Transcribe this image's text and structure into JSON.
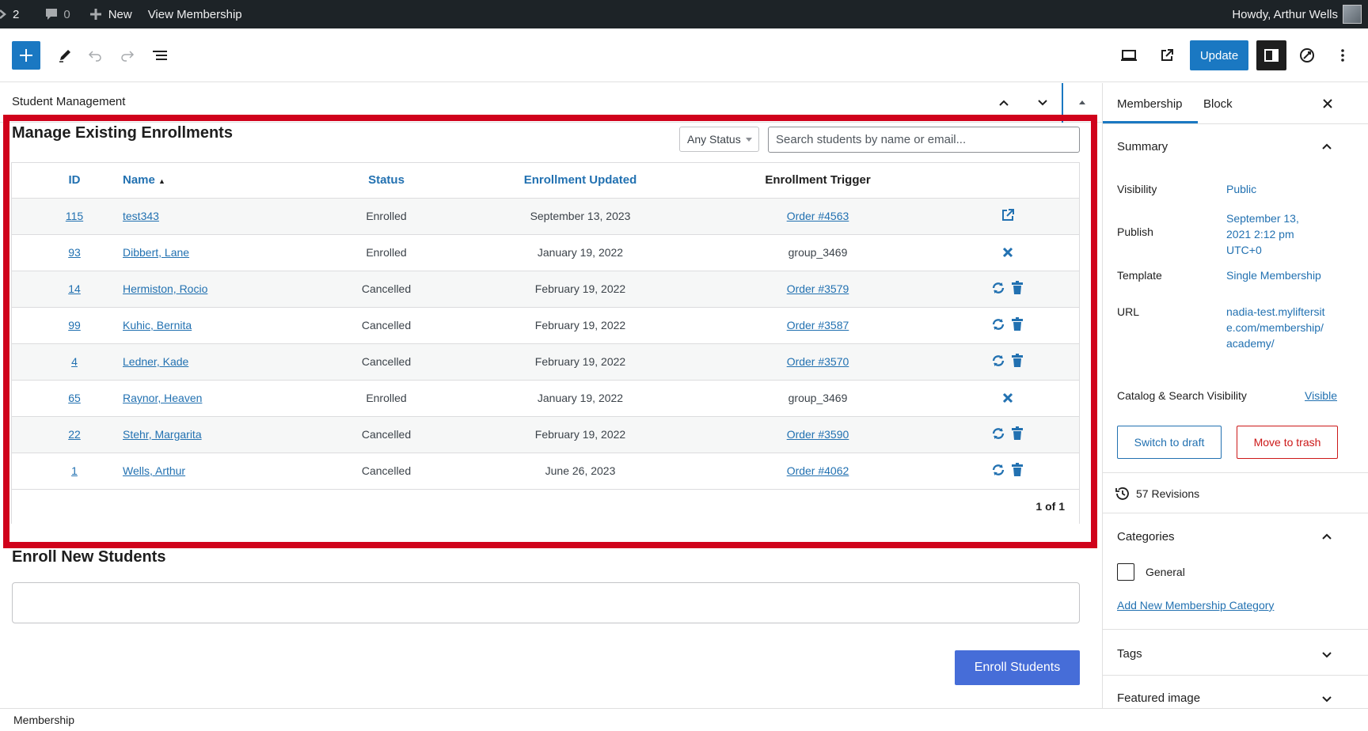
{
  "adminbar": {
    "updates_count": "2",
    "comments_count": "0",
    "new_label": "New",
    "view_label": "View Membership",
    "howdy": "Howdy, Arthur Wells"
  },
  "toolbar": {
    "update_label": "Update"
  },
  "panel": {
    "title": "Student Management"
  },
  "enrollments": {
    "title": "Manage Existing Enrollments",
    "status_filter": "Any Status",
    "search_placeholder": "Search students by name or email...",
    "columns": {
      "id": "ID",
      "name": "Name",
      "name_sort": "▲",
      "status": "Status",
      "updated": "Enrollment Updated",
      "trigger": "Enrollment Trigger"
    },
    "rows": [
      {
        "id": "115",
        "name": "test343",
        "status": "Enrolled",
        "updated": "September 13, 2023",
        "trigger": "Order #4563",
        "trigger_link": true,
        "actions": [
          "external-link"
        ]
      },
      {
        "id": "93",
        "name": "Dibbert, Lane",
        "status": "Enrolled",
        "updated": "January 19, 2022",
        "trigger": "group_3469",
        "trigger_link": false,
        "actions": [
          "close"
        ]
      },
      {
        "id": "14",
        "name": "Hermiston, Rocio",
        "status": "Cancelled",
        "updated": "February 19, 2022",
        "trigger": "Order #3579",
        "trigger_link": true,
        "actions": [
          "reenroll",
          "trash"
        ]
      },
      {
        "id": "99",
        "name": "Kuhic, Bernita",
        "status": "Cancelled",
        "updated": "February 19, 2022",
        "trigger": "Order #3587",
        "trigger_link": true,
        "actions": [
          "reenroll",
          "trash"
        ]
      },
      {
        "id": "4",
        "name": "Ledner, Kade",
        "status": "Cancelled",
        "updated": "February 19, 2022",
        "trigger": "Order #3570",
        "trigger_link": true,
        "actions": [
          "reenroll",
          "trash"
        ]
      },
      {
        "id": "65",
        "name": "Raynor, Heaven",
        "status": "Enrolled",
        "updated": "January 19, 2022",
        "trigger": "group_3469",
        "trigger_link": false,
        "actions": [
          "close"
        ]
      },
      {
        "id": "22",
        "name": "Stehr, Margarita",
        "status": "Cancelled",
        "updated": "February 19, 2022",
        "trigger": "Order #3590",
        "trigger_link": true,
        "actions": [
          "reenroll",
          "trash"
        ]
      },
      {
        "id": "1",
        "name": "Wells, Arthur",
        "status": "Cancelled",
        "updated": "June 26, 2023",
        "trigger": "Order #4062",
        "trigger_link": true,
        "actions": [
          "reenroll",
          "trash"
        ]
      }
    ],
    "pagination": "1 of 1"
  },
  "enroll_new": {
    "title": "Enroll New Students",
    "button_label": "Enroll Students"
  },
  "footer": {
    "breadcrumb": "Membership"
  },
  "sidebar": {
    "tabs": [
      "Membership",
      "Block"
    ],
    "summary": {
      "title": "Summary",
      "visibility_label": "Visibility",
      "visibility_value": "Public",
      "publish_label": "Publish",
      "publish_value": "September 13, 2021 2:12 pm UTC+0",
      "template_label": "Template",
      "template_value": "Single Membership",
      "url_label": "URL",
      "url_value": "nadia-test.myliftersite.com/membership/academy/",
      "catalog_label": "Catalog & Search Visibility",
      "catalog_value": "Visible",
      "switch_draft": "Switch to draft",
      "move_trash": "Move to trash"
    },
    "revisions": "57 Revisions",
    "categories": {
      "title": "Categories",
      "items": [
        "General"
      ],
      "add_new": "Add New Membership Category"
    },
    "tags_title": "Tags",
    "featured_title": "Featured image"
  },
  "colors": {
    "admin_bar": "#1d2327",
    "accent": "#1a78c2",
    "link": "#2271b1",
    "highlight": "#d0021b",
    "enroll_button": "#466dd8",
    "danger": "#cc1818"
  }
}
